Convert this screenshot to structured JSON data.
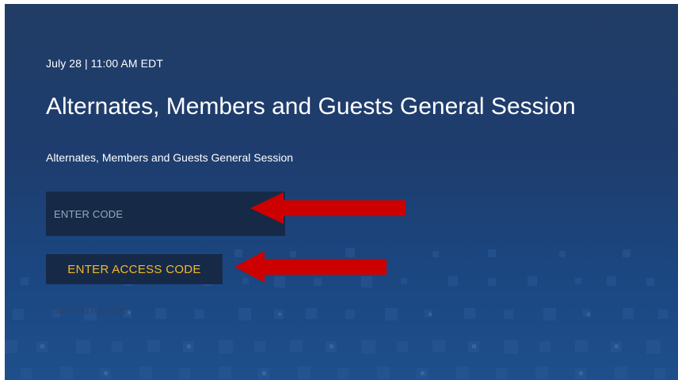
{
  "session": {
    "datetime": "July 28 | 11:00 AM EDT",
    "title": "Alternates, Members and Guests General Session",
    "subtitle": "Alternates, Members and Guests General Session"
  },
  "form": {
    "code_placeholder": "ENTER CODE",
    "code_value": "",
    "submit_label": "ENTER ACCESS CODE",
    "help_link": "I can't find my code"
  },
  "colors": {
    "background": "#1e3d6e",
    "field_background": "#162a48",
    "button_text": "#f2b82e",
    "annotation_arrow": "#cc0000"
  },
  "annotations": [
    {
      "type": "arrow",
      "points_to": "code-input",
      "color": "#cc0000"
    },
    {
      "type": "arrow",
      "points_to": "enter-access-code-button",
      "color": "#cc0000"
    }
  ]
}
